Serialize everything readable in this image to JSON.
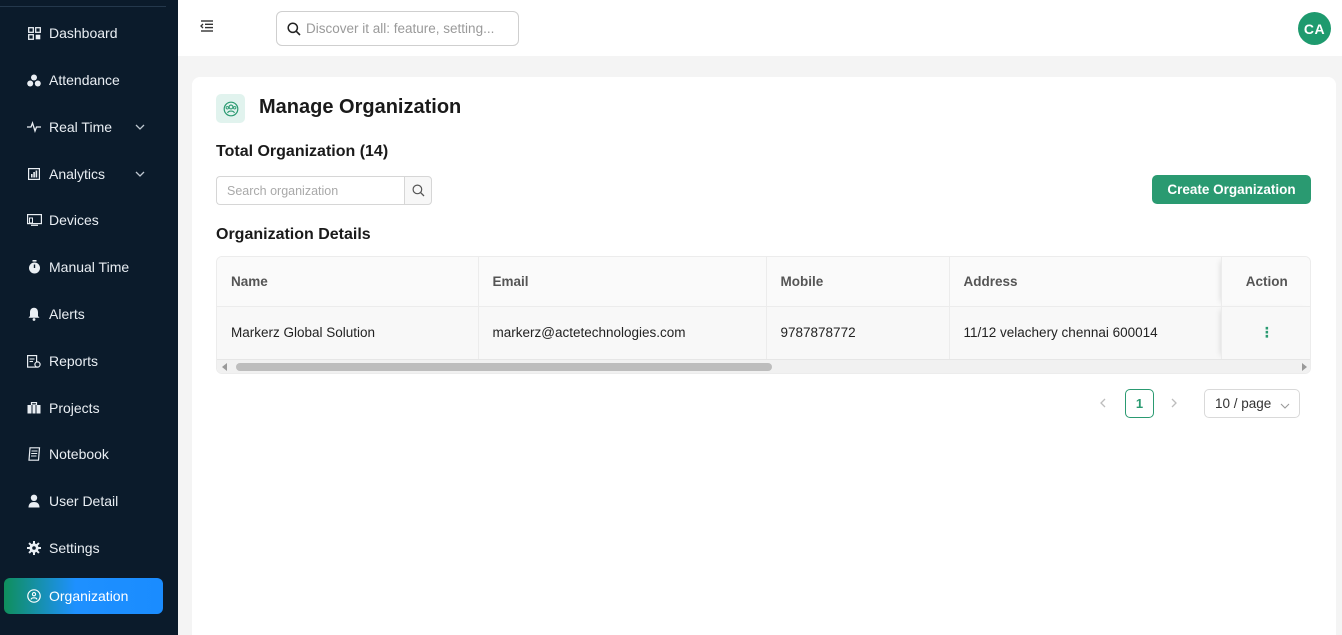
{
  "sidebar": {
    "items": [
      {
        "label": "Dashboard",
        "icon": "dashboard-icon"
      },
      {
        "label": "Attendance",
        "icon": "attendance-icon"
      },
      {
        "label": "Real Time",
        "icon": "pulse-icon",
        "expandable": true
      },
      {
        "label": "Analytics",
        "icon": "analytics-icon",
        "expandable": true
      },
      {
        "label": "Devices",
        "icon": "devices-icon"
      },
      {
        "label": "Manual Time",
        "icon": "stopwatch-icon"
      },
      {
        "label": "Alerts",
        "icon": "bell-icon"
      },
      {
        "label": "Reports",
        "icon": "reports-icon"
      },
      {
        "label": "Projects",
        "icon": "briefcase-icon"
      },
      {
        "label": "Notebook",
        "icon": "notebook-icon"
      },
      {
        "label": "User Detail",
        "icon": "user-icon"
      },
      {
        "label": "Settings",
        "icon": "gear-icon"
      },
      {
        "label": "Organization",
        "icon": "organization-icon",
        "active": true
      }
    ]
  },
  "header": {
    "search_placeholder": "Discover it all: feature, setting...",
    "avatar_initials": "CA"
  },
  "main": {
    "page_title": "Manage Organization",
    "total_label": "Total Organization (14)",
    "search_placeholder": "Search organization",
    "create_button": "Create Organization",
    "section_title": "Organization Details",
    "table": {
      "columns": [
        "Name",
        "Email",
        "Mobile",
        "Address",
        "Action"
      ],
      "rows": [
        {
          "name": "Markerz Global Solution",
          "email": "markerz@actetechnologies.com",
          "mobile": "9787878772",
          "address": "11/12 velachery chennai 600014",
          "action": "⋮"
        }
      ]
    },
    "pagination": {
      "current_page": "1",
      "page_size": "10 / page"
    }
  },
  "colors": {
    "sidebar_bg": "#0b1b2b",
    "accent_green": "#2a9a71",
    "active_gradient_end": "#1a8cff"
  }
}
